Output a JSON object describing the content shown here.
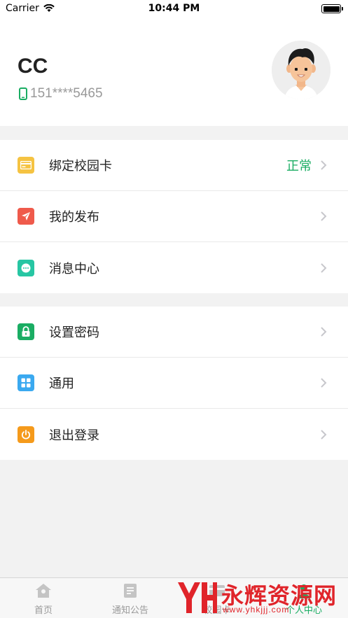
{
  "status_bar": {
    "carrier": "Carrier",
    "time": "10:44 PM"
  },
  "profile": {
    "name": "CC",
    "phone": "151****5465"
  },
  "menu_group_1": [
    {
      "label": "绑定校园卡",
      "value": "正常",
      "icon": "card-icon",
      "color": "#f5c342"
    },
    {
      "label": "我的发布",
      "value": "",
      "icon": "send-icon",
      "color": "#ef5a4b"
    },
    {
      "label": "消息中心",
      "value": "",
      "icon": "chat-icon",
      "color": "#27c6a3"
    }
  ],
  "menu_group_2": [
    {
      "label": "设置密码",
      "value": "",
      "icon": "lock-icon",
      "color": "#1aad63"
    },
    {
      "label": "通用",
      "value": "",
      "icon": "grid-icon",
      "color": "#3aa9f0"
    },
    {
      "label": "退出登录",
      "value": "",
      "icon": "power-icon",
      "color": "#f59a1b"
    }
  ],
  "tabbar": [
    {
      "label": "首页",
      "icon": "home-icon",
      "active": false
    },
    {
      "label": "通知公告",
      "icon": "notice-icon",
      "active": false
    },
    {
      "label": "校园卡",
      "icon": "campus-card-icon",
      "active": false
    },
    {
      "label": "个人中心",
      "icon": "person-icon",
      "active": true
    }
  ],
  "watermark": {
    "text": "永辉资源网",
    "url": "www.yhkjjj.com"
  },
  "colors": {
    "accent": "#1aad63",
    "background": "#f2f2f2"
  }
}
